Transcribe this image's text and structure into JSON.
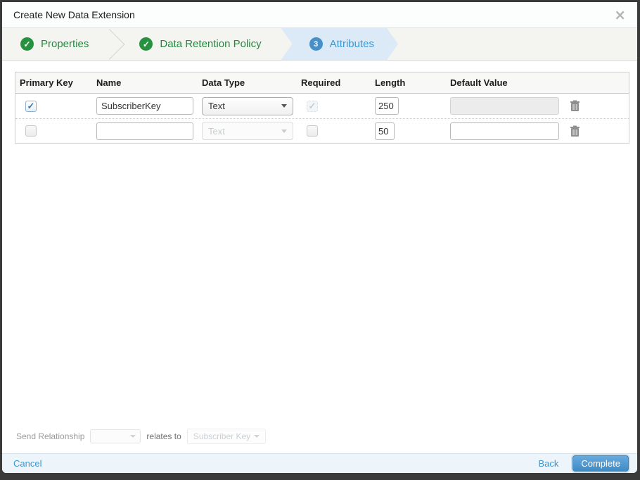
{
  "window": {
    "title": "Create New Data Extension"
  },
  "icons": {
    "close": "×",
    "check": "✓"
  },
  "wizard": {
    "steps": [
      {
        "label": "Properties",
        "status": "complete"
      },
      {
        "label": "Data Retention Policy",
        "status": "complete"
      },
      {
        "label": "Attributes",
        "status": "current",
        "number": "3"
      }
    ]
  },
  "attributes_table": {
    "headers": [
      "Primary Key",
      "Name",
      "Data Type",
      "Required",
      "Length",
      "Default Value"
    ],
    "rows": [
      {
        "primary_key_checked": true,
        "name": "SubscriberKey",
        "data_type": "Text",
        "data_type_disabled": false,
        "required_checked": true,
        "required_disabled": true,
        "length": "250",
        "default_value": "",
        "default_value_disabled": true
      },
      {
        "primary_key_checked": false,
        "name": "",
        "data_type": "Text",
        "data_type_disabled": true,
        "required_checked": false,
        "required_disabled": false,
        "length": "50",
        "default_value": "",
        "default_value_disabled": false
      }
    ]
  },
  "send_relationship": {
    "label": "Send Relationship",
    "relates_label": "relates to",
    "target_value": "Subscriber Key"
  },
  "footer": {
    "cancel_label": "Cancel",
    "back_label": "Back",
    "complete_label": "Complete"
  },
  "colors": {
    "accent_green": "#27913f",
    "accent_blue": "#3c98d4",
    "active_step_bg": "#dbeaf6",
    "complete_button": "#4a96cf",
    "frame": "#3a3a3a"
  }
}
